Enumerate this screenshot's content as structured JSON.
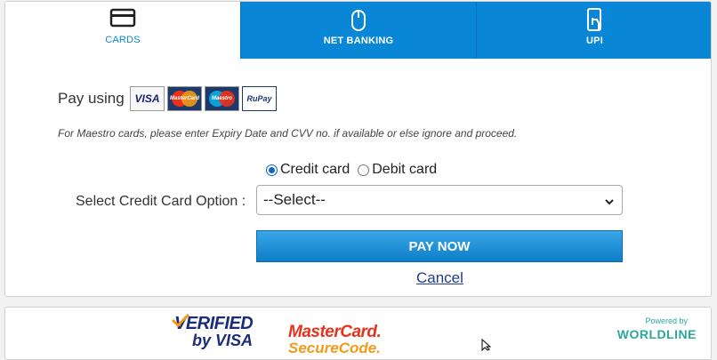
{
  "tabs": [
    {
      "label": "CARDS",
      "icon": "card-icon",
      "active": true
    },
    {
      "label": "NET BANKING",
      "icon": "mouse-icon",
      "active": false
    },
    {
      "label": "UPI",
      "icon": "phone-tap-icon",
      "active": false
    }
  ],
  "pay_using": {
    "label": "Pay using",
    "logos": [
      {
        "name": "visa",
        "text": "VISA"
      },
      {
        "name": "mastercard",
        "text": "MasterCard"
      },
      {
        "name": "maestro",
        "text": "Maestro"
      },
      {
        "name": "rupay",
        "text": "RuPay"
      }
    ]
  },
  "note": "For Maestro cards, please enter Expiry Date and CVV no. if available or else ignore and proceed.",
  "card_type": {
    "options": [
      "Credit card",
      "Debit card"
    ],
    "selected": "Credit card"
  },
  "select": {
    "label": "Select Credit Card Option :",
    "value": "--Select--"
  },
  "pay_button": "PAY NOW",
  "cancel_link": "Cancel",
  "footer": {
    "verified_line1": "VERIFIED",
    "verified_line2": "by VISA",
    "securecode_line1": "MasterCard.",
    "securecode_line2": "SecureCode.",
    "powered_by": "Powered by",
    "provider": "WORLDLINE"
  },
  "colors": {
    "accent": "#0a86d6",
    "link": "#1e3c8c",
    "worldline": "#2aa89a"
  }
}
